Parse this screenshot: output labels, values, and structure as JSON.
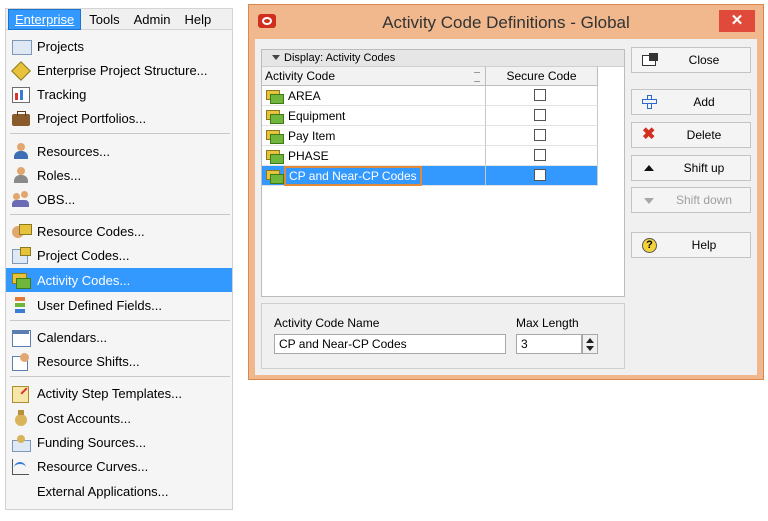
{
  "menubar": {
    "items": [
      "Enterprise",
      "Tools",
      "Admin",
      "Help"
    ]
  },
  "menu": {
    "items": [
      {
        "label": "Projects",
        "icon": "folder-icon"
      },
      {
        "label": "Enterprise Project Structure...",
        "icon": "eps-icon"
      },
      {
        "label": "Tracking",
        "icon": "tracking-chart-icon"
      },
      {
        "label": "Project Portfolios...",
        "icon": "briefcase-icon"
      },
      {
        "label": "Resources...",
        "icon": "person-icon"
      },
      {
        "label": "Roles...",
        "icon": "role-person-icon"
      },
      {
        "label": "OBS...",
        "icon": "obs-people-icon"
      },
      {
        "label": "Resource Codes...",
        "icon": "resource-codes-icon"
      },
      {
        "label": "Project Codes...",
        "icon": "project-codes-icon"
      },
      {
        "label": "Activity Codes...",
        "icon": "activity-codes-icon"
      },
      {
        "label": "User Defined Fields...",
        "icon": "udf-icon"
      },
      {
        "label": "Calendars...",
        "icon": "calendar-icon"
      },
      {
        "label": "Resource Shifts...",
        "icon": "resource-shifts-icon"
      },
      {
        "label": "Activity Step Templates...",
        "icon": "step-template-icon"
      },
      {
        "label": "Cost Accounts...",
        "icon": "money-bag-icon"
      },
      {
        "label": "Funding Sources...",
        "icon": "funding-icon"
      },
      {
        "label": "Resource Curves...",
        "icon": "curve-chart-icon"
      },
      {
        "label": "External Applications...",
        "icon": ""
      }
    ],
    "highlighted": "Activity Codes..."
  },
  "dialog": {
    "title": "Activity Code Definitions - Global",
    "close_glyph": "✕",
    "display_label": "Display: Activity Codes",
    "columns": [
      "Activity Code",
      "Secure Code"
    ],
    "rows": [
      {
        "name": "AREA",
        "secure": false
      },
      {
        "name": "Equipment",
        "secure": false
      },
      {
        "name": "Pay Item",
        "secure": false
      },
      {
        "name": "PHASE",
        "secure": false
      },
      {
        "name": "CP and Near-CP Codes",
        "secure": false,
        "selected": true
      }
    ],
    "name_label": "Activity Code Name",
    "name_value": "CP and Near-CP Codes",
    "maxlen_label": "Max Length",
    "maxlen_value": "3",
    "buttons": {
      "close": "Close",
      "add": "Add",
      "delete": "Delete",
      "shift_up": "Shift up",
      "shift_down": "Shift down",
      "help": "Help"
    }
  },
  "colors": {
    "highlight": "#3399ff",
    "dialog_frame": "#f0b88c",
    "close_red": "#e04a3a"
  }
}
